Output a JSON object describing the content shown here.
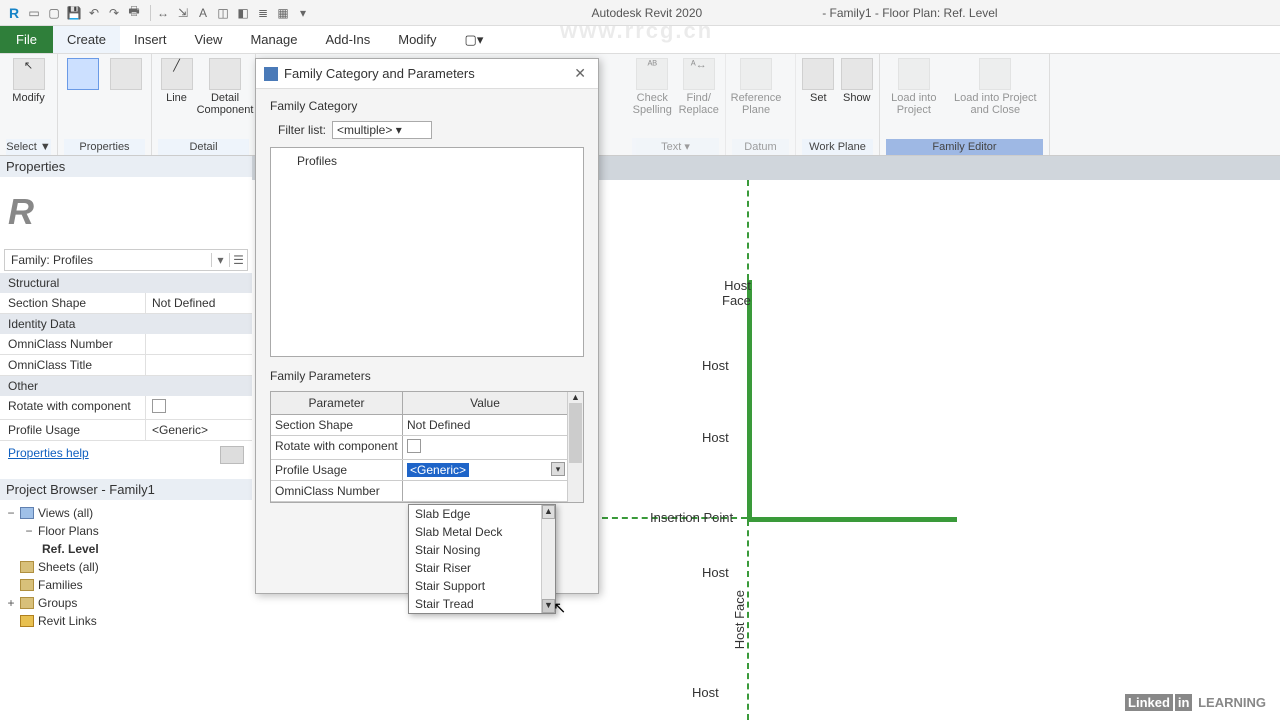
{
  "app": {
    "name": "Autodesk Revit 2020",
    "doc_title": "- Family1 - Floor Plan: Ref. Level"
  },
  "menu": {
    "file": "File",
    "tabs": [
      "Create",
      "Insert",
      "View",
      "Manage",
      "Add-Ins",
      "Modify"
    ]
  },
  "ribbon": {
    "modify": "Modify",
    "select": "Select ▼",
    "properties": "Properties",
    "line": "Line",
    "detail_component": "Detail Component",
    "detail": "Detail",
    "check_spelling": "Check Spelling",
    "find_replace": "Find/ Replace",
    "text": "Text",
    "reference_plane": "Reference Plane",
    "datum": "Datum",
    "set": "Set",
    "show": "Show",
    "work_plane": "Work Plane",
    "load_project": "Load into Project",
    "load_project_close": "Load into Project and Close",
    "family_editor": "Family Editor"
  },
  "properties": {
    "title": "Properties",
    "family_select": "Family: Profiles",
    "groups": {
      "structural": "Structural",
      "identity": "Identity Data",
      "other": "Other"
    },
    "rows": {
      "section_shape_k": "Section Shape",
      "section_shape_v": "Not Defined",
      "omni_num_k": "OmniClass Number",
      "omni_title_k": "OmniClass Title",
      "rotate_k": "Rotate with component",
      "profile_usage_k": "Profile Usage",
      "profile_usage_v": "<Generic>"
    },
    "help": "Properties help"
  },
  "browser": {
    "title": "Project Browser - Family1",
    "views": "Views (all)",
    "floor_plans": "Floor Plans",
    "ref_level": "Ref. Level",
    "sheets": "Sheets (all)",
    "families": "Families",
    "groups": "Groups",
    "revit_links": "Revit Links"
  },
  "dialog": {
    "title": "Family Category and Parameters",
    "family_category": "Family Category",
    "filter_label": "Filter list:",
    "filter_value": "<multiple>",
    "category_item": "Profiles",
    "family_parameters": "Family Parameters",
    "col_param": "Parameter",
    "col_value": "Value",
    "rows": [
      {
        "k": "Section Shape",
        "v": "Not Defined"
      },
      {
        "k": "Rotate with component",
        "v": ""
      },
      {
        "k": "Profile Usage",
        "v": "<Generic>"
      },
      {
        "k": "OmniClass Number",
        "v": ""
      }
    ]
  },
  "dropdown": {
    "options": [
      "Slab Edge",
      "Slab Metal Deck",
      "Stair Nosing",
      "Stair Riser",
      "Stair Support",
      "Stair Tread"
    ]
  },
  "canvas": {
    "host_face": "Host\nFace",
    "host": "Host",
    "insertion_point": "Insertion Point",
    "host_face_v": "Host Face"
  },
  "watermark_url": "www.rrcg.cn",
  "brand": {
    "linked": "Linked",
    "in": "in",
    "learn": "LEARNING"
  }
}
